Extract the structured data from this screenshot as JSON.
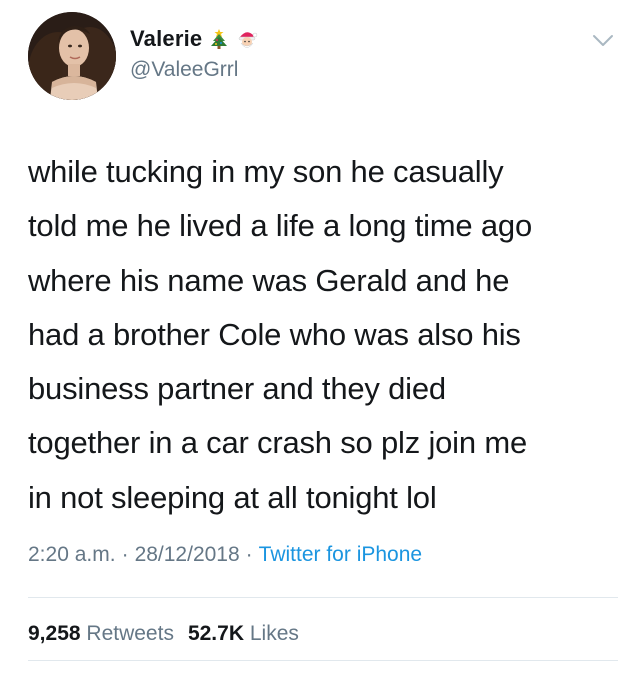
{
  "user": {
    "display_name": "Valerie",
    "handle": "@ValeeGrrl",
    "name_emojis": [
      "christmas-tree",
      "santa"
    ]
  },
  "tweet": {
    "lines": [
      "while tucking in my son he casually",
      "told me he lived a life a long time ago",
      "where his name was Gerald and he",
      "had a brother Cole who was also his",
      "business partner and they died",
      "together in a car crash so plz join me",
      "in not sleeping at all tonight lol"
    ]
  },
  "meta": {
    "time": "2:20 a.m.",
    "separator": "·",
    "date": "28/12/2018",
    "source": "Twitter for iPhone"
  },
  "stats": {
    "retweets_count": "9,258",
    "retweets_label": "Retweets",
    "likes_count": "52.7K",
    "likes_label": "Likes"
  },
  "colors": {
    "text": "#14171a",
    "secondary": "#657786",
    "link": "#1b95e0",
    "divider": "#e1e8ed"
  }
}
